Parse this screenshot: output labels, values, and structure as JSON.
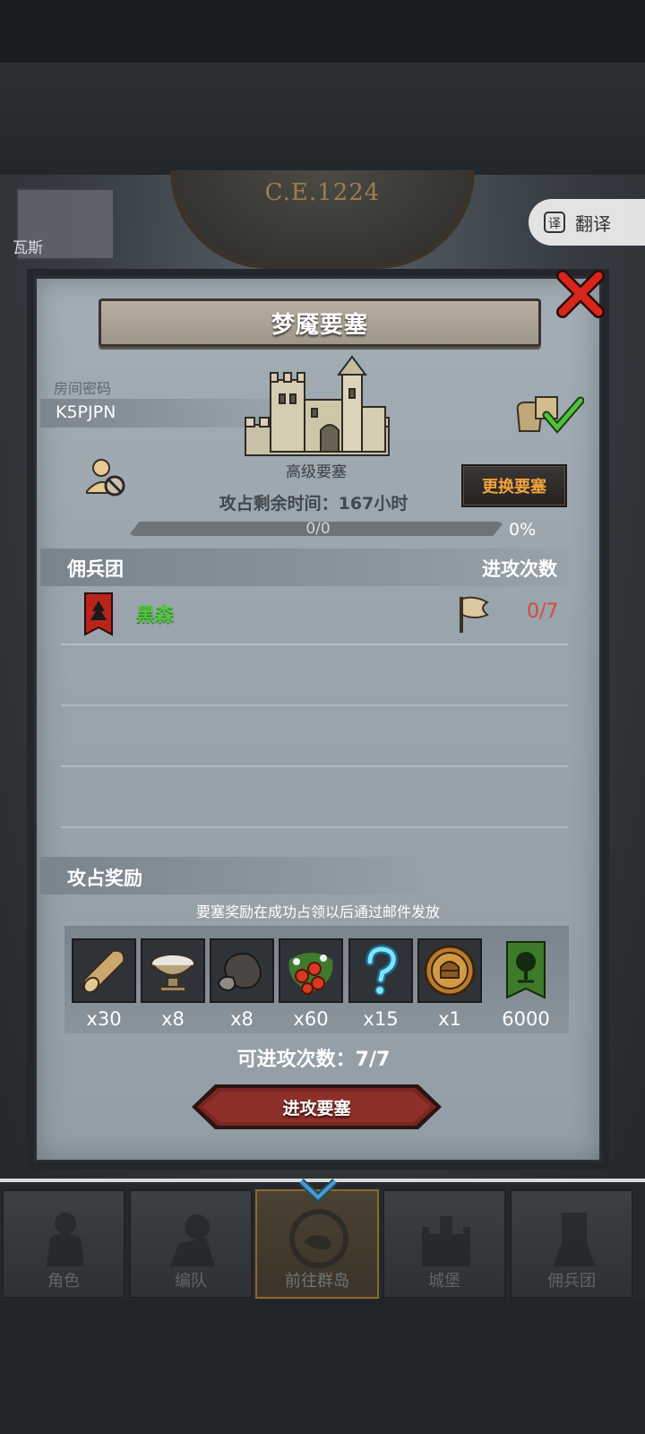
{
  "background": {
    "year": "C.E.1224",
    "left_card_label": "瓦斯"
  },
  "translate_button": {
    "label": "翻译",
    "icon": "translate-icon"
  },
  "dialog": {
    "title": "梦魇要塞",
    "room_code_label": "房间密码",
    "room_code": "K5PJPN",
    "castle_name": "高级要塞",
    "change_fortress_label": "更换要塞",
    "occupy_time_label": "攻占剩余时间：",
    "occupy_time_value": "167",
    "occupy_time_unit": "小时",
    "progress": {
      "count": "0/0",
      "percent": "0%",
      "fraction": 0.0
    },
    "mercenary_header": {
      "left": "佣兵团",
      "right": "进攻次数"
    },
    "mercenaries": [
      {
        "name": "黑森",
        "attacks": "0/7",
        "banner_color": "#b8241c"
      }
    ],
    "reward_header": "攻占奖励",
    "reward_note": "要塞奖励在成功占领以后通过邮件发放",
    "rewards": [
      {
        "icon": "wood-log-icon",
        "qty": "x30"
      },
      {
        "icon": "silver-bowl-icon",
        "qty": "x8"
      },
      {
        "icon": "ore-icon",
        "qty": "x8"
      },
      {
        "icon": "berries-icon",
        "qty": "x60"
      },
      {
        "icon": "mystery-question-icon",
        "qty": "x15"
      },
      {
        "icon": "knight-medal-icon",
        "qty": "x1"
      },
      {
        "icon": "tree-banner-icon",
        "qty": "6000"
      }
    ],
    "attack_available_label": "可进攻次数：",
    "attack_available_value": "7/7",
    "attack_button_label": "进攻要塞"
  },
  "navbar": {
    "items": [
      {
        "label": "角色",
        "icon": "character-icon",
        "active": false
      },
      {
        "label": "编队",
        "icon": "formation-icon",
        "active": false
      },
      {
        "label": "前往群岛",
        "icon": "island-icon",
        "active": true
      },
      {
        "label": "城堡",
        "icon": "castle-icon",
        "active": false
      },
      {
        "label": "佣兵团",
        "icon": "mercenary-icon",
        "active": false
      }
    ]
  },
  "colors": {
    "accent_orange": "#f2a23c",
    "merc_green": "#4fc93a",
    "attack_red": "#d9483f",
    "button_red": "#7a2520"
  }
}
